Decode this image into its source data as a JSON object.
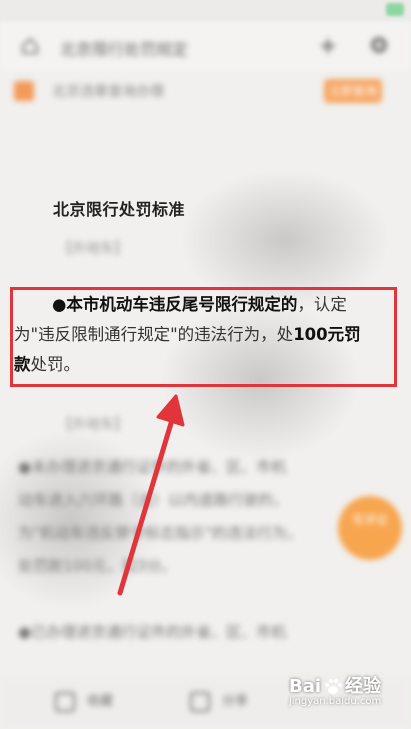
{
  "top_nav": {
    "title": "北京限行处罚规定"
  },
  "banner": {
    "text": "北京违章查询办理",
    "button": "立即查询"
  },
  "article": {
    "heading": "北京限行处罚标准",
    "section_labels": [
      "【外地车】",
      "【外地车】"
    ],
    "rule": {
      "bullet": "●",
      "bold_1": "本市机动车违反尾号限行规定的",
      "text_1": "，认定",
      "text_2": "为\"违反限制通行规定\"的违法行为，处",
      "bold_2": "100元罚",
      "bold_3": "款",
      "text_3": "处罚。"
    },
    "para_1": [
      "●未办理进京通行证件的外省、区、市机",
      "动车进入六环路（含）以内道路行驶的，",
      "为\"机动车违反禁令标志指示\"的违法行为，",
      "处罚款100元，扣3分。"
    ],
    "para_2": [
      "●已办理进京通行证件的外省、区、市机"
    ]
  },
  "float_button": {
    "label": "写评论"
  },
  "bottom_bar": {
    "item_1": "收藏",
    "item_2": "分享"
  },
  "watermark": {
    "brand_left": "Bai",
    "brand_right": "经验",
    "sub": "jingyan.baidu.com"
  },
  "colors": {
    "highlight": "#e0353b",
    "accent": "#f6a562"
  }
}
